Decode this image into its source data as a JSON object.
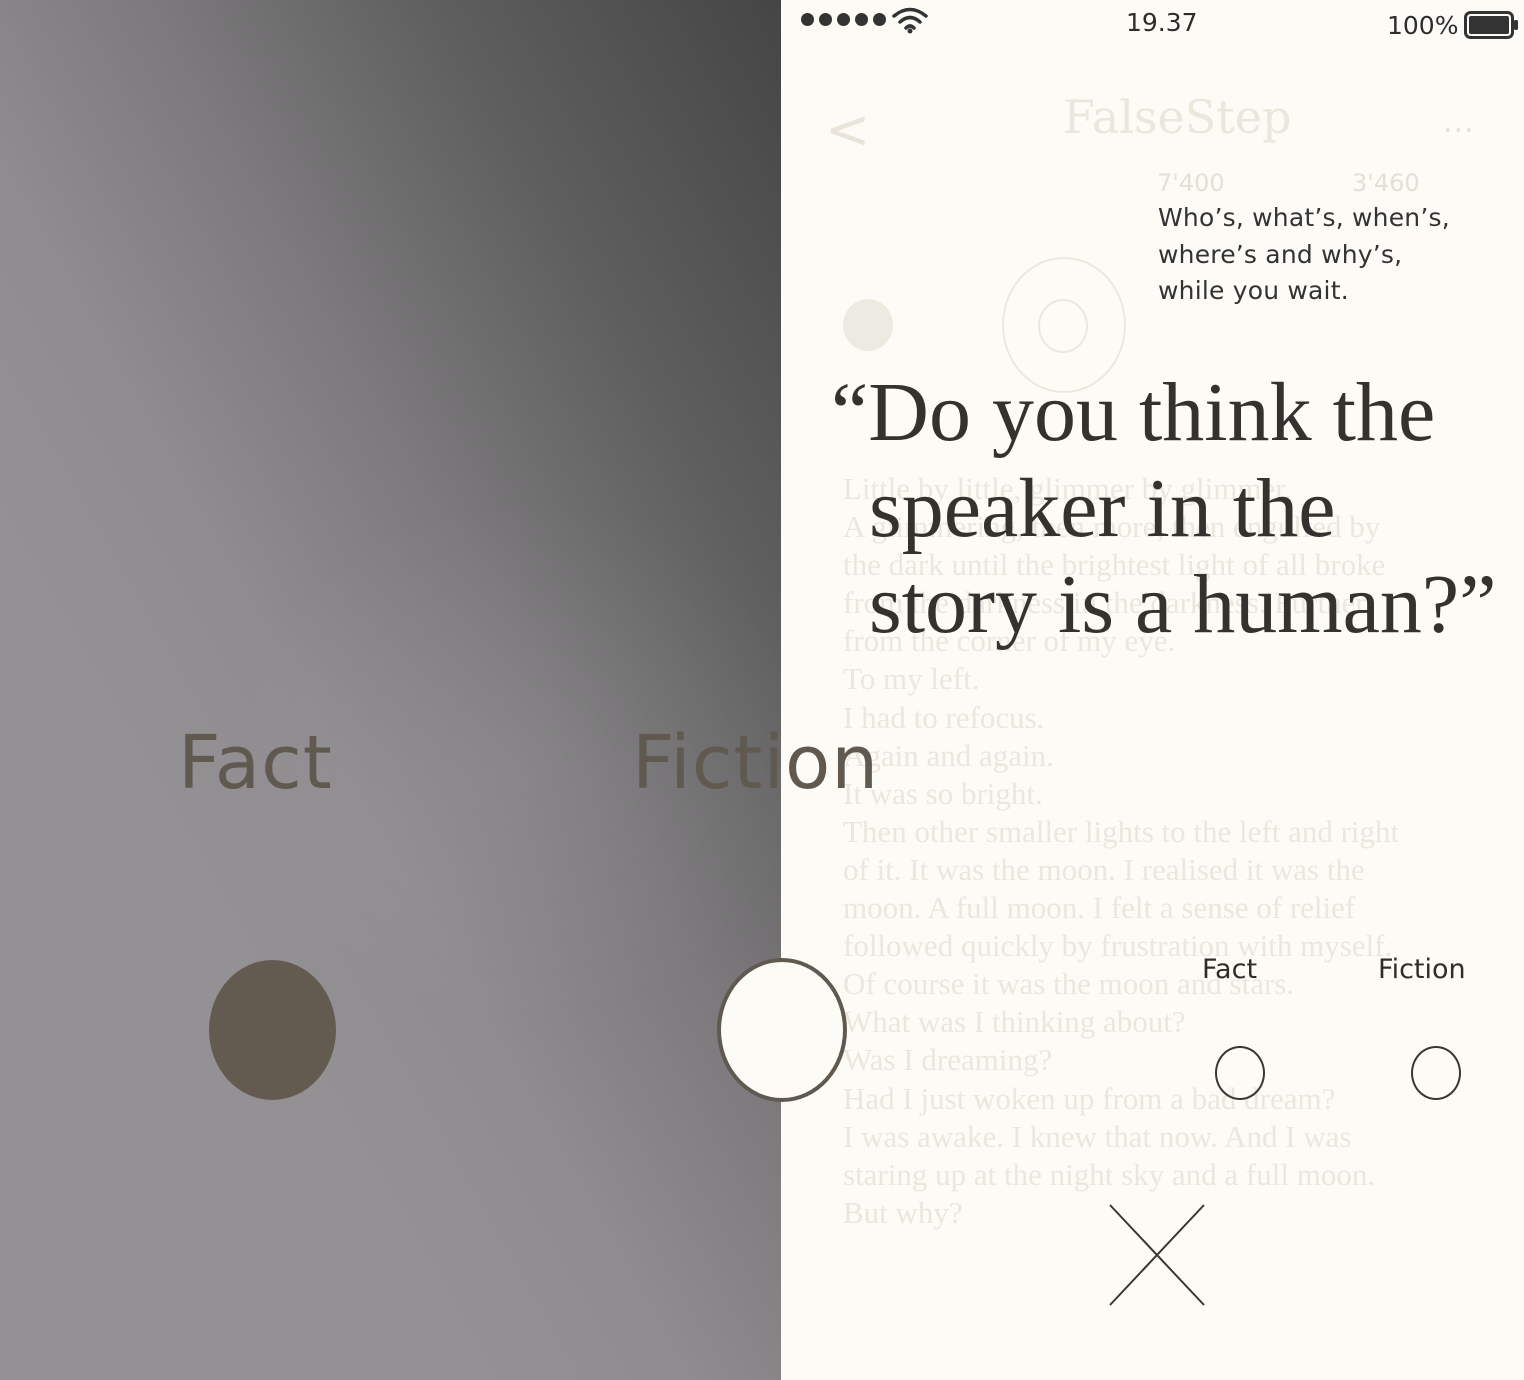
{
  "zoomed_panel": {
    "fact_label": "Fact",
    "fiction_label": "Fiction",
    "fact_selected": true,
    "fiction_selected": false
  },
  "status_bar": {
    "signal_bars": 5,
    "wifi_icon": "wifi-icon",
    "time": "19.37",
    "battery_percent": "100%",
    "battery_icon": "battery-full-icon"
  },
  "background_app": {
    "back_label": "<",
    "title": "FalseStep",
    "more_label": "...",
    "stats": [
      "7'400",
      "3'460"
    ],
    "story_lines": [
      "Little by little, glimmer by glimmer.",
      "A glimmering, then more, then engulfed by",
      "the dark until the brightest light of all broke",
      "from the darkness in the darkness. Further",
      "from the corner of my eye.",
      "To my left.",
      "I had to refocus.",
      "Again and again.",
      "It was so bright.",
      "Then other smaller lights to the left and right",
      "of it. It was the moon. I realised it was the",
      "moon. A full moon. I felt a sense of relief",
      "followed quickly by frustration with myself.",
      "Of course it was the moon and stars.",
      "What was I thinking about?",
      "Was I dreaming?",
      "Had I just woken up from a bad dream?",
      "I was awake. I knew that now. And I was",
      "staring up at the night sky and a full moon.",
      "But why?"
    ]
  },
  "overlay": {
    "tagline_lines": [
      "Who’s, what’s, when’s,",
      "where’s and why’s,",
      "while you wait."
    ],
    "question_lines": [
      "“Do you think the",
      "speaker in the",
      "story is a human?”"
    ],
    "options": [
      {
        "label": "Fact",
        "selected": false
      },
      {
        "label": "Fiction",
        "selected": false
      }
    ],
    "close_icon": "close-icon"
  }
}
